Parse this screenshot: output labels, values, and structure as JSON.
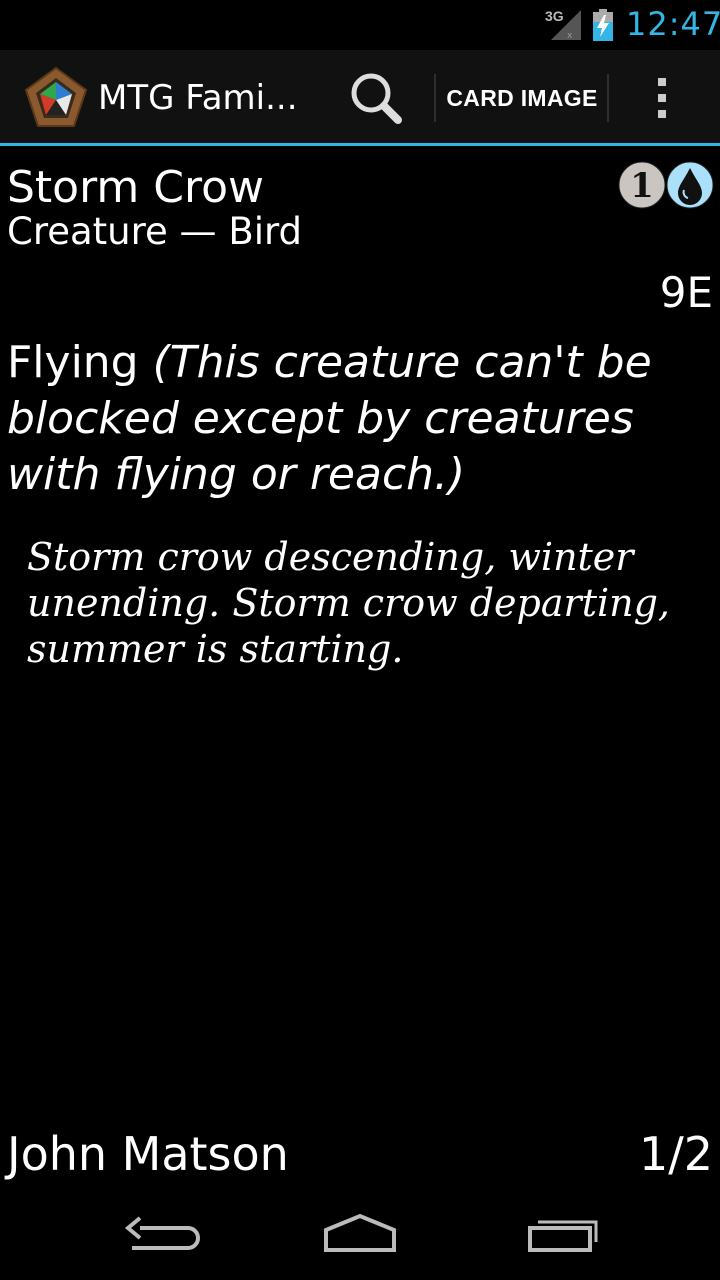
{
  "status_bar": {
    "network_label": "3G",
    "time": "12:47",
    "accent_color": "#33b5e5",
    "icons": [
      "signal-icon",
      "battery-charging-icon"
    ]
  },
  "action_bar": {
    "app_title": "MTG Fami...",
    "card_image_label": "CARD IMAGE",
    "icons": [
      "app-logo-icon",
      "search-icon",
      "overflow-menu-icon"
    ]
  },
  "card": {
    "name": "Storm Crow",
    "type_line": "Creature — Bird",
    "mana_cost": [
      "1",
      "U"
    ],
    "set": "9E",
    "rules_keyword": "Flying ",
    "rules_reminder": "(This creature can't be blocked except by creatures with flying or reach.)",
    "flavor": "Storm crow descending, winter unending. Storm crow departing, summer is starting.",
    "artist": "John Matson",
    "power_toughness": "1/2"
  },
  "nav_bar": {
    "icons": [
      "back-icon",
      "home-icon",
      "recent-apps-icon"
    ]
  }
}
